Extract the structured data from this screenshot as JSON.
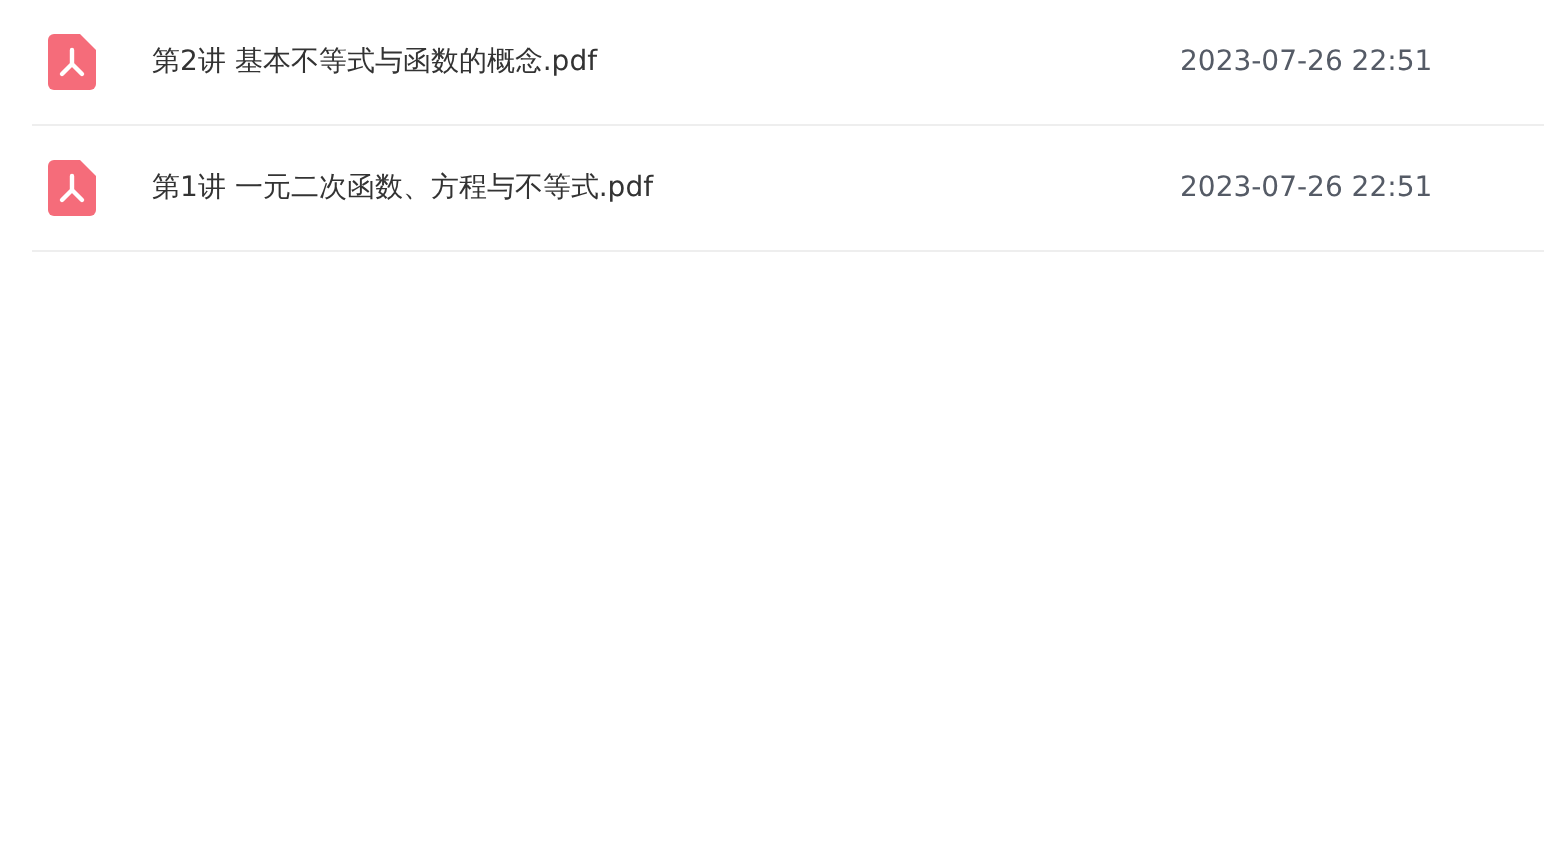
{
  "files": [
    {
      "name": "第2讲 基本不等式与函数的概念.pdf",
      "date": "2023-07-26 22:51"
    },
    {
      "name": "第1讲 一元二次函数、方程与不等式.pdf",
      "date": "2023-07-26 22:51"
    }
  ]
}
